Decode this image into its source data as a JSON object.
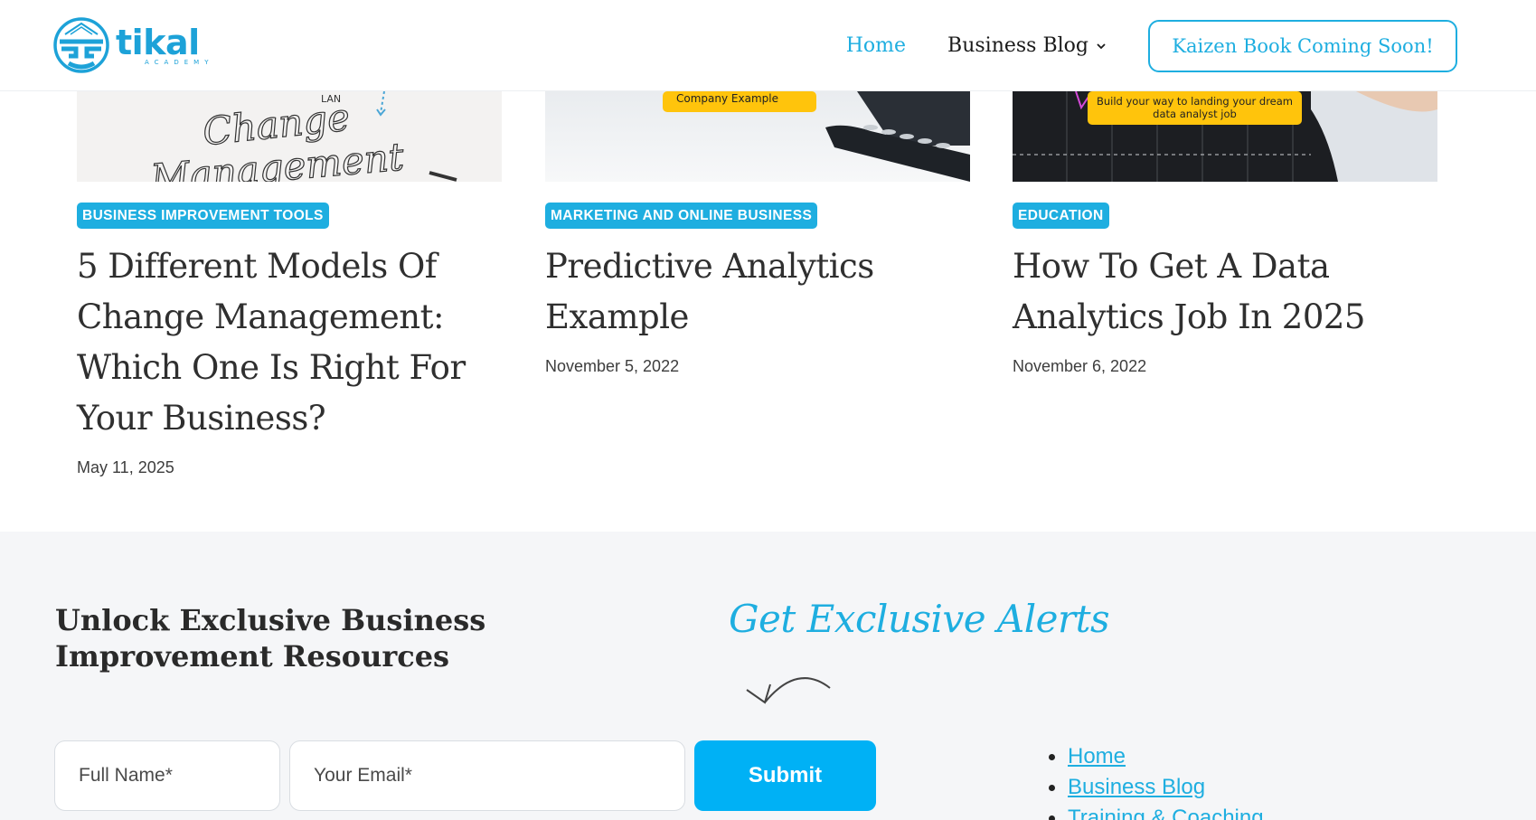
{
  "header": {
    "logo_name": "tikal",
    "logo_sub": "ACADEMY",
    "nav": {
      "home": "Home",
      "blog": "Business Blog"
    },
    "cta": "Kaizen Book Coming Soon!"
  },
  "cards": [
    {
      "category": "BUSINESS IMPROVEMENT TOOLS",
      "title": "5 Different Models Of Change Management: Which One Is Right For Your Business?",
      "date": "May 11, 2025",
      "image_text_a": "LAN",
      "image_text_b": "Change",
      "image_text_c": "Management"
    },
    {
      "category": "MARKETING AND ONLINE BUSINESS",
      "title": "Predictive Analytics Example",
      "date": "November 5, 2022",
      "image_text": "Company Example"
    },
    {
      "category": "EDUCATION",
      "title": "How To Get A Data Analytics Job In 2025",
      "date": "November 6, 2022",
      "image_text": "Build your way to landing your dream data analyst job"
    }
  ],
  "footer": {
    "heading": "Unlock Exclusive Business Improvement Resources",
    "alerts": "Get Exclusive Alerts",
    "name_placeholder": "Full Name*",
    "email_placeholder": "Your Email*",
    "submit": "Submit",
    "links": [
      "Home",
      "Business Blog",
      "Training & Coaching"
    ]
  },
  "colors": {
    "accent": "#1eaee0",
    "submit_bg": "#00b1f5",
    "footer_bg": "#f5f6f8"
  }
}
